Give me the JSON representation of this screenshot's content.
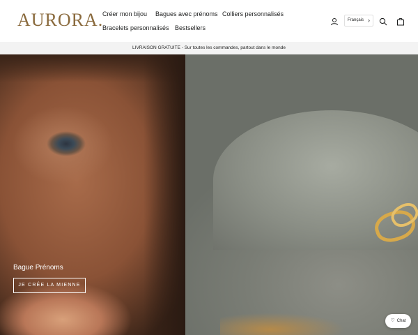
{
  "header": {
    "logo": "AURORA.",
    "nav": [
      {
        "label": "Créer mon bijou"
      },
      {
        "label": "Bagues avec prénoms"
      },
      {
        "label": "Colliers personnalisés"
      },
      {
        "label": "Bracelets personnalisés"
      },
      {
        "label": "Bestsellers"
      }
    ],
    "icons": [
      "user-icon",
      "search-icon",
      "cart-icon"
    ],
    "language": "Français",
    "language_chevron": "›"
  },
  "announcement": {
    "bold": "LIVRAISON GRATUITE",
    "text": " - Sur toutes les commandes, partout dans le monde"
  },
  "hero": {
    "title": "Bague Prénoms",
    "button": "JE CRÉE LA MIENNE"
  },
  "chat": {
    "label": "Chat",
    "icon": "♡"
  },
  "colors": {
    "logo": "#8a6a3d",
    "ring": "#d7a94a"
  }
}
